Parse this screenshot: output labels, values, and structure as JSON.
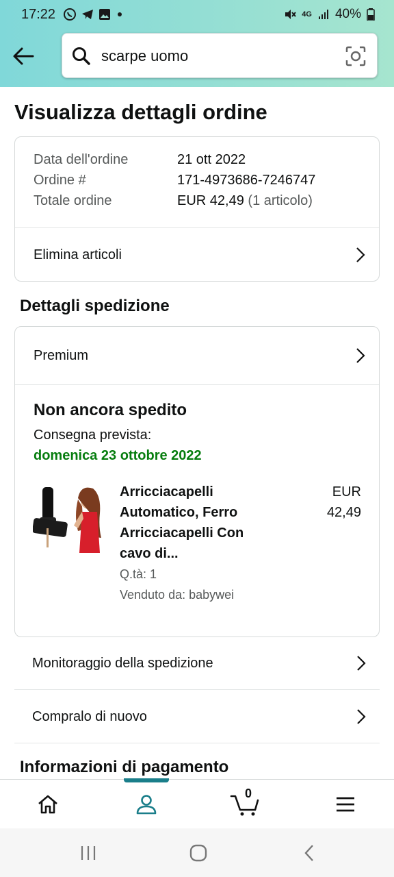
{
  "status_bar": {
    "time": "17:22",
    "battery": "40%",
    "network": "4G"
  },
  "search": {
    "query": "scarpe uomo"
  },
  "page": {
    "title": "Visualizza dettagli ordine"
  },
  "order": {
    "date_label": "Data dell'ordine",
    "date_value": "21 ott 2022",
    "number_label": "Ordine #",
    "number_value": "171-4973686-7246747",
    "total_label": "Totale ordine",
    "total_value": "EUR 42,49",
    "total_items": "(1 articolo)",
    "remove_items": "Elimina articoli"
  },
  "shipping": {
    "section_title": "Dettagli spedizione",
    "service": "Premium",
    "status": "Non ancora spedito",
    "delivery_label": "Consegna prevista:",
    "delivery_date": "domenica 23 ottobre 2022",
    "item": {
      "title": "Arricciacapelli Automatico, Ferro Arricciacapelli Con cavo di...",
      "price_currency": "EUR",
      "price_value": "42,49",
      "quantity": "Q.tà: 1",
      "seller": "Venduto da: babywei"
    }
  },
  "actions": {
    "track": "Monitoraggio della spedizione",
    "buy_again": "Compralo di nuovo"
  },
  "payment": {
    "section_title": "Informazioni di pagamento"
  },
  "bottom_nav": {
    "cart_count": "0",
    "active": "account"
  },
  "colors": {
    "header_gradient_start": "#80d8d9",
    "header_gradient_end": "#a6e5cf",
    "delivery_green": "#067d0e",
    "nav_accent": "#1a7e8a"
  },
  "icons": [
    "back-arrow-icon",
    "search-icon",
    "camera-lens-icon",
    "chevron-right-icon",
    "home-icon",
    "person-icon",
    "cart-icon",
    "menu-icon"
  ]
}
